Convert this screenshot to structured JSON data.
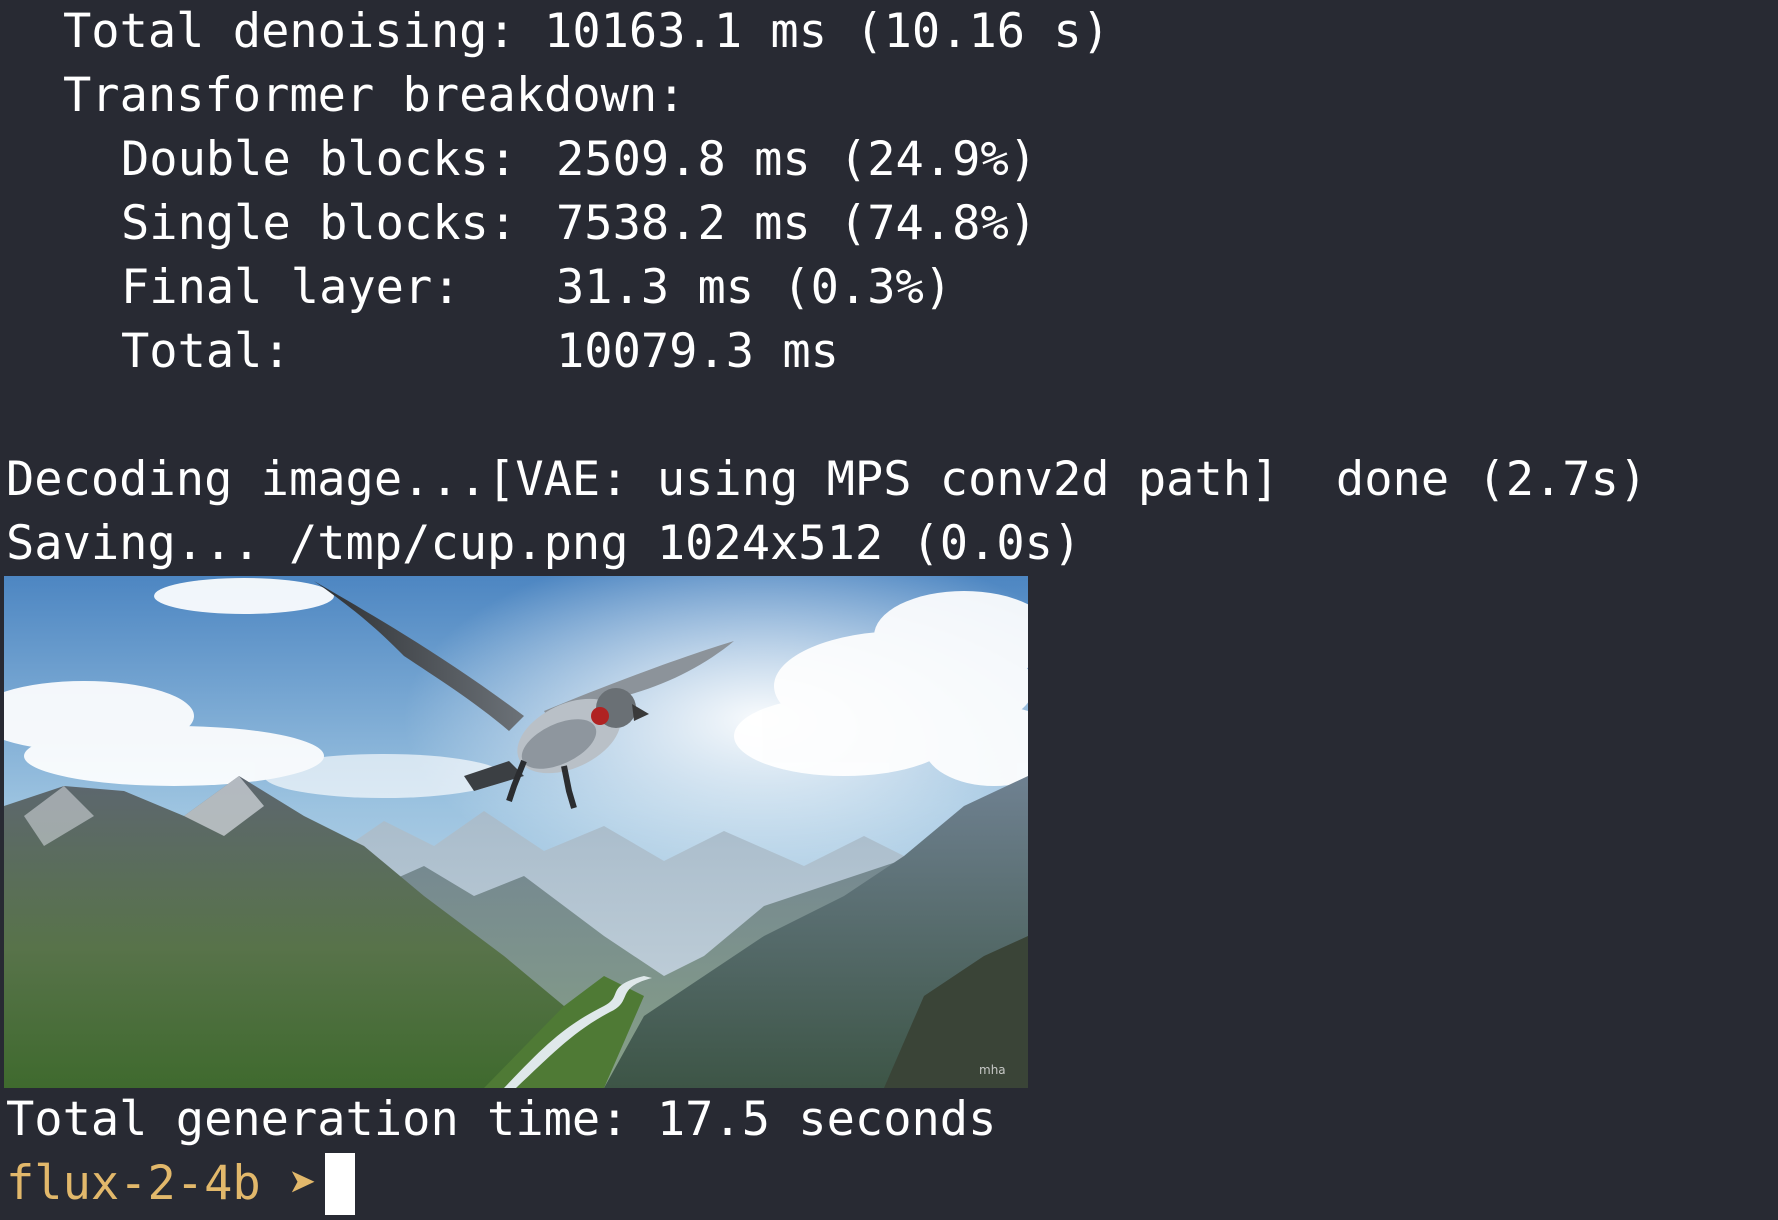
{
  "summary": {
    "total_denoising": "Total denoising: 10163.1 ms (10.16 s)",
    "breakdown_header": "Transformer breakdown:",
    "rows": [
      {
        "label": "Double blocks:",
        "value": "2509.8 ms (24.9%)"
      },
      {
        "label": "Single blocks:",
        "value": "7538.2 ms (74.8%)"
      },
      {
        "label": "Final layer:",
        "value": "31.3 ms (0.3%)"
      },
      {
        "label": "Total:",
        "value": "10079.3 ms"
      }
    ]
  },
  "decode": {
    "decoding_line": "Decoding image...[VAE: using MPS conv2d path]  done (2.7s)",
    "saving_line": "Saving... /tmp/cup.png 1024x512 (0.0s)"
  },
  "image": {
    "subject": "mechanical eagle flying over mountain valley"
  },
  "footer": {
    "total_time": "Total generation time: 17.5 seconds"
  },
  "prompt": {
    "name": "flux-2-4b",
    "arrow": "➤",
    "color": "#e2b86b"
  },
  "colors": {
    "background": "#282a33",
    "text": "#ffffff"
  }
}
